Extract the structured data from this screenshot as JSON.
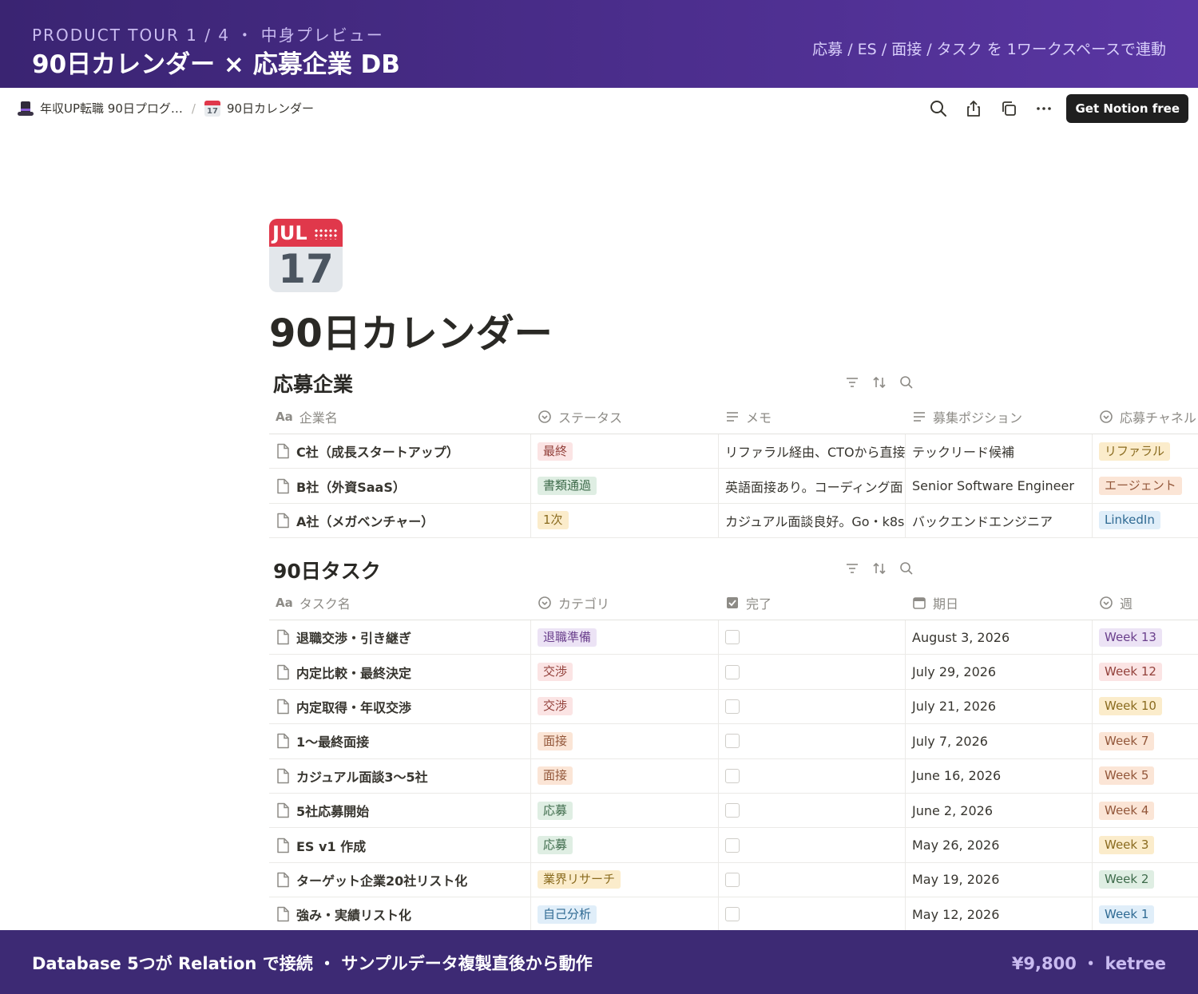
{
  "banner": {
    "kicker": "PRODUCT TOUR 1 / 4 ・ 中身プレビュー",
    "headline": "90日カレンダー × 応募企業 DB",
    "tagline": "応募 / ES / 面接 / タスク を 1ワークスペースで連動"
  },
  "topbar": {
    "breadcrumb_parent": "年収UP転職 90日プログ…",
    "breadcrumb_separator": "/",
    "breadcrumb_current": "90日カレンダー",
    "mini_cal_day": "17",
    "cta_label": "Get Notion free",
    "icons": [
      "search-icon",
      "share-icon",
      "duplicate-icon",
      "more-icon"
    ]
  },
  "page": {
    "icon_month": "JUL",
    "icon_day": "17",
    "title": "90日カレンダー"
  },
  "companies": {
    "title": "応募企業",
    "columns": [
      "企業名",
      "ステータス",
      "メモ",
      "募集ポジション",
      "応募チャネル"
    ],
    "rows": [
      {
        "name": "C社（成長スタートアップ）",
        "status": "最終",
        "status_bg": "#fbe4e4",
        "status_fg": "#93413b",
        "memo": "リファラル経由、CTOから直接",
        "position": "テックリード候補",
        "channel": "リファラル",
        "channel_bg": "#fbeccb",
        "channel_fg": "#8a6b1f"
      },
      {
        "name": "B社（外資SaaS）",
        "status": "書類通過",
        "status_bg": "#dfeee3",
        "status_fg": "#3e6b4b",
        "memo": "英語面接あり。コーディング面",
        "position": "Senior Software Engineer",
        "channel": "エージェント",
        "channel_bg": "#fbe5d6",
        "channel_fg": "#93573a"
      },
      {
        "name": "A社（メガベンチャー）",
        "status": "1次",
        "status_bg": "#fbeccb",
        "status_fg": "#8a6b1f",
        "memo": "カジュアル面談良好。Go・k8s",
        "position": "バックエンドエンジニア",
        "channel": "LinkedIn",
        "channel_bg": "#e0eef9",
        "channel_fg": "#2f6a93"
      }
    ]
  },
  "tasks": {
    "title": "90日タスク",
    "columns": [
      "タスク名",
      "カテゴリ",
      "完了",
      "期日",
      "週"
    ],
    "rows": [
      {
        "name": "退職交渉・引き継ぎ",
        "category": "退職準備",
        "cat_bg": "#ece3f5",
        "cat_fg": "#6a3f8c",
        "done": false,
        "date": "August 3, 2026",
        "week": "Week 13",
        "week_bg": "#ece3f5",
        "week_fg": "#6a3f8c"
      },
      {
        "name": "内定比較・最終決定",
        "category": "交渉",
        "cat_bg": "#fbe4e4",
        "cat_fg": "#93413b",
        "done": false,
        "date": "July 29, 2026",
        "week": "Week 12",
        "week_bg": "#fbe4e4",
        "week_fg": "#93413b"
      },
      {
        "name": "内定取得・年収交渉",
        "category": "交渉",
        "cat_bg": "#fbe4e4",
        "cat_fg": "#93413b",
        "done": false,
        "date": "July 21, 2026",
        "week": "Week 10",
        "week_bg": "#fbeccb",
        "week_fg": "#8a6b1f"
      },
      {
        "name": "1〜最終面接",
        "category": "面接",
        "cat_bg": "#fbe5d6",
        "cat_fg": "#93573a",
        "done": false,
        "date": "July 7, 2026",
        "week": "Week 7",
        "week_bg": "#fbe5d6",
        "week_fg": "#93573a"
      },
      {
        "name": "カジュアル面談3〜5社",
        "category": "面接",
        "cat_bg": "#fbe5d6",
        "cat_fg": "#93573a",
        "done": false,
        "date": "June 16, 2026",
        "week": "Week 5",
        "week_bg": "#fbe5d6",
        "week_fg": "#93573a"
      },
      {
        "name": "5社応募開始",
        "category": "応募",
        "cat_bg": "#dfeee3",
        "cat_fg": "#3e6b4b",
        "done": false,
        "date": "June 2, 2026",
        "week": "Week 4",
        "week_bg": "#fbe5d6",
        "week_fg": "#93573a"
      },
      {
        "name": "ES v1 作成",
        "category": "応募",
        "cat_bg": "#dfeee3",
        "cat_fg": "#3e6b4b",
        "done": false,
        "date": "May 26, 2026",
        "week": "Week 3",
        "week_bg": "#fbeccb",
        "week_fg": "#8a6b1f"
      },
      {
        "name": "ターゲット企業20社リスト化",
        "category": "業界リサーチ",
        "cat_bg": "#fbeccb",
        "cat_fg": "#8a6b1f",
        "done": false,
        "date": "May 19, 2026",
        "week": "Week 2",
        "week_bg": "#dfeee3",
        "week_fg": "#3e6b4b"
      },
      {
        "name": "強み・実績リスト化",
        "category": "自己分析",
        "cat_bg": "#e0eef9",
        "cat_fg": "#2f6a93",
        "done": false,
        "date": "May 12, 2026",
        "week": "Week 1",
        "week_bg": "#e0eef9",
        "week_fg": "#2f6a93"
      }
    ]
  },
  "footer": {
    "left": "Database 5つが Relation で接続 ・ サンプルデータ複製直後から動作",
    "right": "¥9,800 ・ ketree"
  }
}
